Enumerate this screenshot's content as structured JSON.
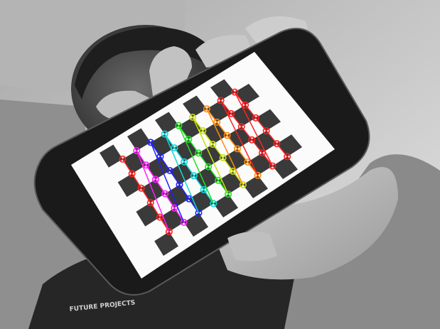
{
  "scene": {
    "description_tags": [
      "grayscale-photo",
      "person-holding-phone",
      "checkerboard-calibration"
    ],
    "shirt_print_text": "FUTURE PROJECTS"
  },
  "calibration": {
    "pattern": "checkerboard",
    "inner_corner_columns": 9,
    "inner_corner_rows": 6,
    "row_colors": [
      "#ff2020",
      "#ff20ff",
      "#2020ff",
      "#10d8d8",
      "#20e020",
      "#c8e010",
      "#ff8c10",
      "#ff2020"
    ]
  }
}
